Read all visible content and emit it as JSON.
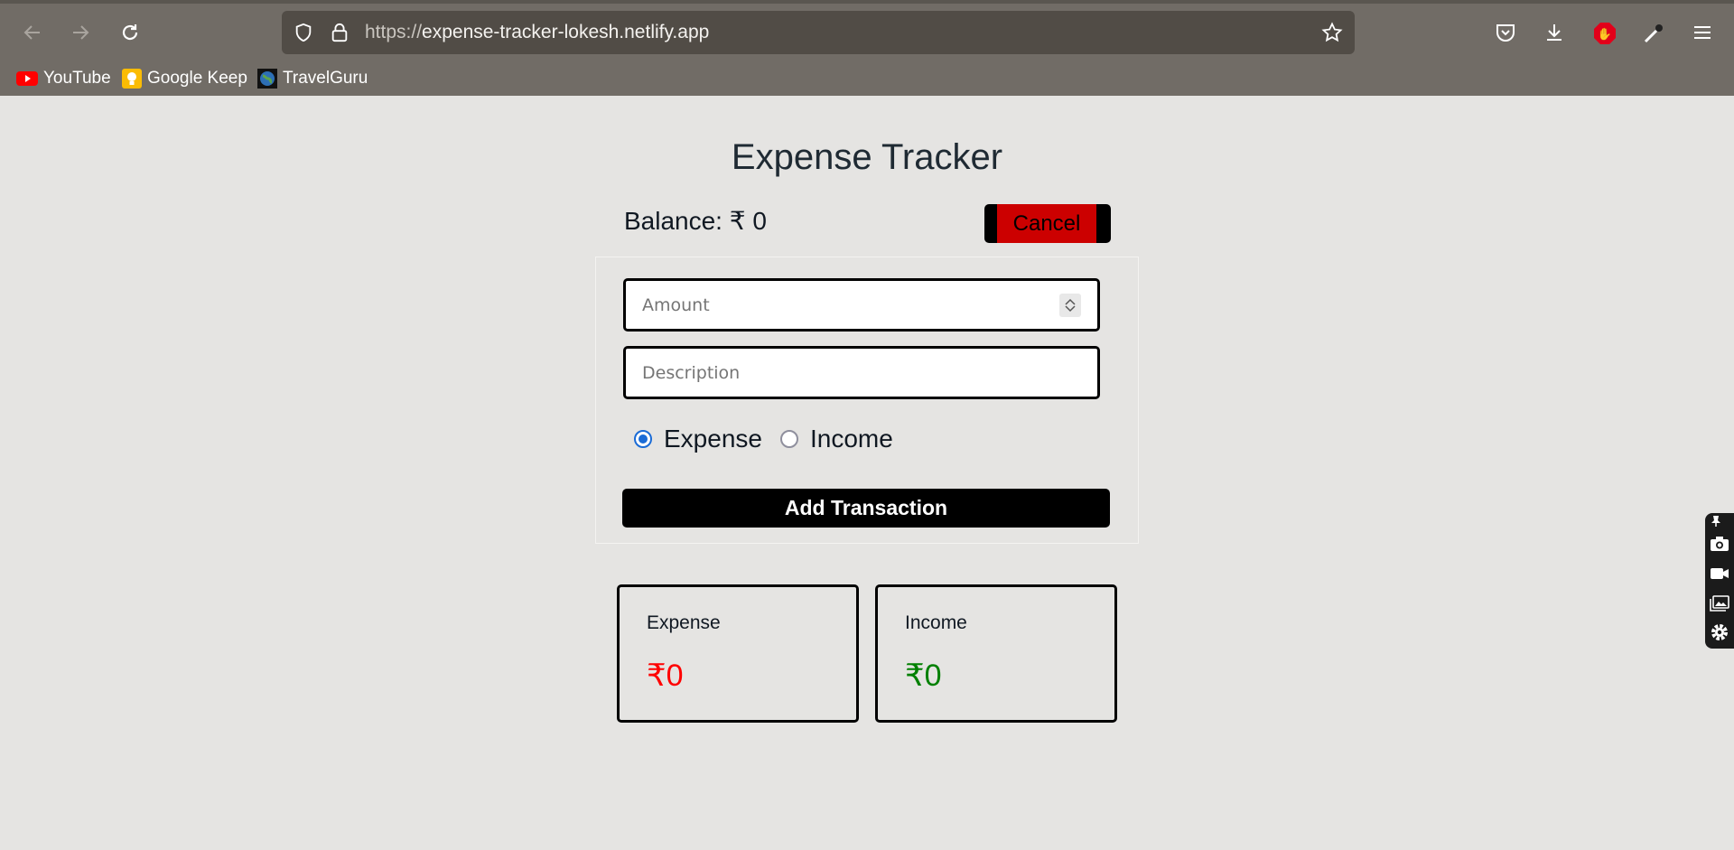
{
  "browser": {
    "url_protocol": "https://",
    "url_host": "expense-tracker-lokesh.netlify.app",
    "bookmarks": [
      {
        "label": "YouTube",
        "icon": "youtube-icon"
      },
      {
        "label": "Google Keep",
        "icon": "google-keep-icon"
      },
      {
        "label": "TravelGuru",
        "icon": "globe-icon"
      }
    ]
  },
  "app": {
    "title": "Expense Tracker",
    "balance_label": "Balance: ₹ 0",
    "cancel_label": "Cancel",
    "amount_placeholder": "Amount",
    "description_placeholder": "Description",
    "radio_expense": "Expense",
    "radio_income": "Income",
    "selected_type": "Expense",
    "add_label": "Add Transaction",
    "expense_card": {
      "label": "Expense",
      "value": "₹0",
      "color": "#ff0000"
    },
    "income_card": {
      "label": "Income",
      "value": "₹0",
      "color": "#008000"
    }
  },
  "colors": {
    "cancel_bg": "#cc0000",
    "radio_accent": "#1a6bd6",
    "chrome_bg": "#716c66",
    "page_bg": "#e5e4e2"
  }
}
